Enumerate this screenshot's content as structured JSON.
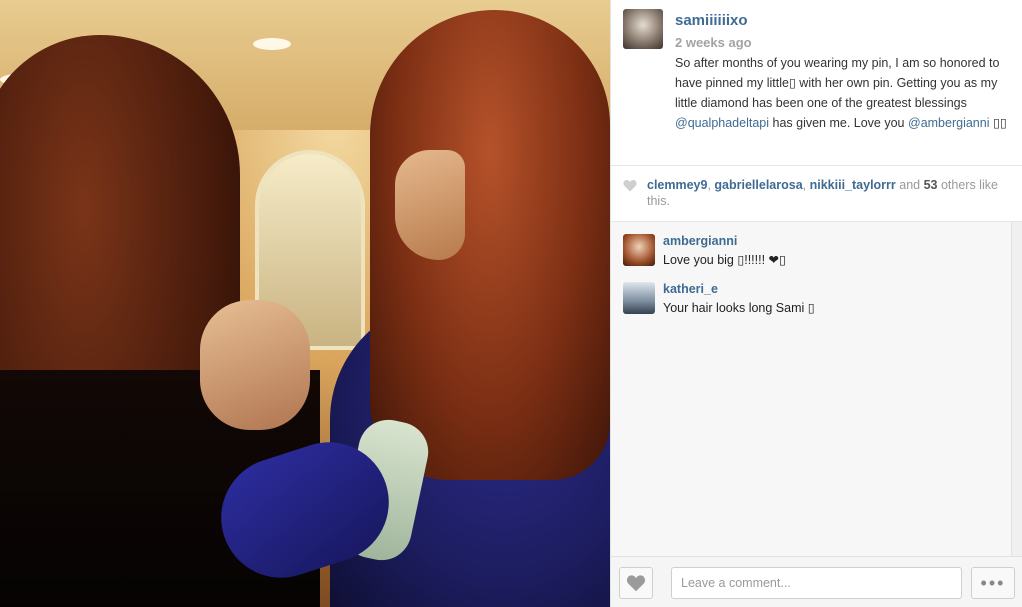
{
  "post": {
    "author": "samiiiiiixo",
    "time": "2 weeks ago",
    "caption_part1": "So after months of you wearing my pin, I am so honored to have pinned my little▯ with her own pin. Getting you as my little diamond has been one of the greatest blessings ",
    "caption_mention1": "@qualphadeltapi",
    "caption_part2": " has given me. Love you ",
    "caption_mention2": "@ambergianni",
    "caption_part3": " ▯▯"
  },
  "likes": {
    "user1": "clemmey9",
    "sep1": ", ",
    "user2": "gabriellelarosa",
    "sep2": ", ",
    "user3": "nikkiii_taylorrr",
    "and_text": " and ",
    "count": "53",
    "suffix": " others like this."
  },
  "comments": [
    {
      "user": "ambergianni",
      "text": "Love you big ▯!!!!!! ❤▯"
    },
    {
      "user": "katheri_e",
      "text": "Your hair looks long Sami ▯"
    }
  ],
  "comment_box": {
    "placeholder": "Leave a comment..."
  },
  "more_button": {
    "label": "•••"
  },
  "icons": {
    "like": "heart-icon",
    "more": "ellipsis-icon"
  },
  "colors": {
    "link": "#3f6b93",
    "muted": "#a3a3a3",
    "panel_bg": "#ffffff",
    "comments_bg": "#f7f7f7"
  }
}
